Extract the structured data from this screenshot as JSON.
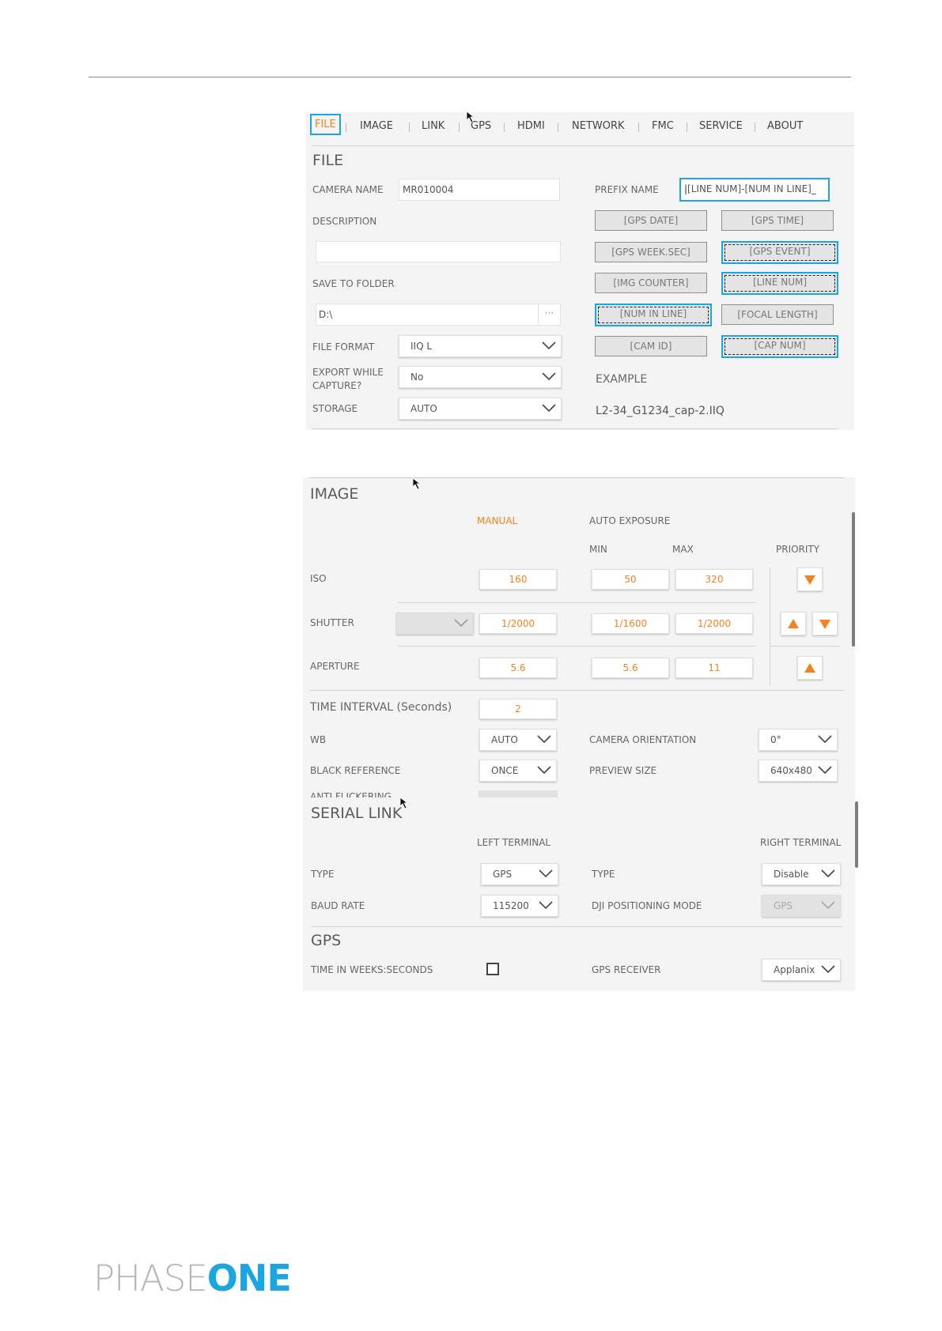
{
  "tabs": [
    {
      "label": "FILE",
      "active": true
    },
    {
      "label": "IMAGE"
    },
    {
      "label": "LINK"
    },
    {
      "label": "GPS"
    },
    {
      "label": "HDMI"
    },
    {
      "label": "NETWORK"
    },
    {
      "label": "FMC"
    },
    {
      "label": "SERVICE"
    },
    {
      "label": "ABOUT"
    }
  ],
  "file": {
    "title": "FILE",
    "camera_name_label": "CAMERA NAME",
    "camera_name_value": "MR010004",
    "description_label": "DESCRIPTION",
    "description_value": "",
    "save_to_folder_label": "SAVE TO FOLDER",
    "save_to_folder_value": "D:\\",
    "browse_label": "···",
    "file_format_label": "FILE FORMAT",
    "file_format_value": "IIQ L",
    "export_while_capture_label_1": "EXPORT WHILE",
    "export_while_capture_label_2": "CAPTURE?",
    "export_while_capture_value": "No",
    "storage_label": "STORAGE",
    "storage_value": "AUTO",
    "prefix_name_label": "PREFIX NAME",
    "prefix_name_value": "[LINE NUM]-[NUM IN LINE]_",
    "tokens": [
      {
        "label": "[GPS DATE]"
      },
      {
        "label": "[GPS TIME]"
      },
      {
        "label": "[GPS WEEK.SEC]"
      },
      {
        "label": "[GPS EVENT]",
        "selected": true
      },
      {
        "label": "[IMG COUNTER]"
      },
      {
        "label": "[LINE NUM]",
        "selected": true
      },
      {
        "label": "[NUM IN LINE]",
        "selected": true
      },
      {
        "label": "[FOCAL LENGTH]"
      },
      {
        "label": "[CAM ID]"
      },
      {
        "label": "[CAP NUM]",
        "selected": true
      }
    ],
    "example_label": "EXAMPLE",
    "example_value": "L2-34_G1234_cap-2.IIQ"
  },
  "image": {
    "title": "IMAGE",
    "manual_label": "MANUAL",
    "auto_exposure_label": "AUTO EXPOSURE",
    "min_label": "MIN",
    "max_label": "MAX",
    "priority_label": "PRIORITY",
    "iso_label": "ISO",
    "iso_manual": "160",
    "iso_min": "50",
    "iso_max": "320",
    "shutter_label": "SHUTTER",
    "shutter_manual": "1/2000",
    "shutter_min": "1/1600",
    "shutter_max": "1/2000",
    "aperture_label": "APERTURE",
    "aperture_manual": "5.6",
    "aperture_min": "5.6",
    "aperture_max": "11",
    "time_interval_label": "TIME INTERVAL (Seconds)",
    "time_interval_value": "2",
    "wb_label": "WB",
    "wb_value": "AUTO",
    "camera_orientation_label": "CAMERA ORIENTATION",
    "camera_orientation_value": "0°",
    "black_reference_label": "BLACK REFERENCE",
    "black_reference_value": "ONCE",
    "preview_size_label": "PREVIEW SIZE",
    "preview_size_value": "640x480",
    "anti_flickering_label": "ANTI FLICKERING"
  },
  "serial_link": {
    "title": "SERIAL LINK",
    "left_terminal_label": "LEFT TERMINAL",
    "right_terminal_label": "RIGHT TERMINAL",
    "type_label": "TYPE",
    "left_type_value": "GPS",
    "right_type_label": "TYPE",
    "right_type_value": "Disable",
    "baud_rate_label": "BAUD RATE",
    "baud_rate_value": "115200",
    "dji_label": "DJI POSITIONING MODE",
    "dji_value": "GPS"
  },
  "gps": {
    "title": "GPS",
    "time_in_weeks_label": "TIME IN WEEKS:SECONDS",
    "time_in_weeks_checked": false,
    "gps_receiver_label": "GPS RECEIVER",
    "gps_receiver_value": "Applanix"
  },
  "logo": {
    "part1": "PHASE",
    "part2": "ONE",
    "brand_color": "#1aa6e0"
  },
  "colors": {
    "accent": "#f58220",
    "selection": "#1aa6e0"
  }
}
